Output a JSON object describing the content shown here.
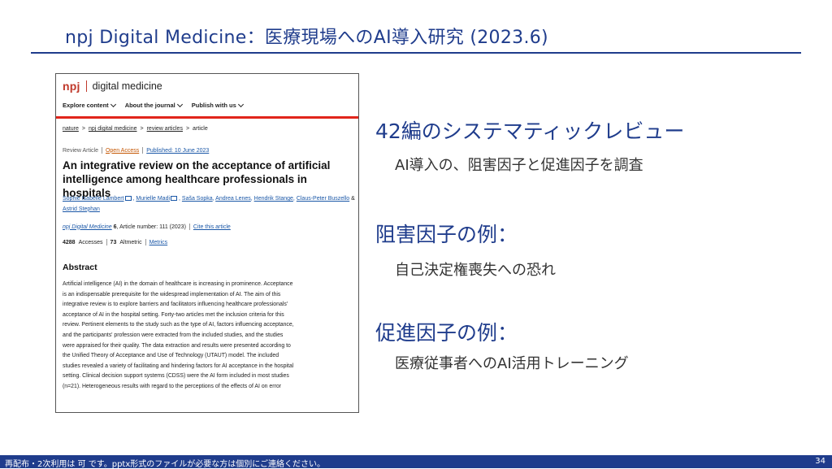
{
  "slide": {
    "title": "npj Digital Medicine：医療現場へのAI導入研究 (2023.6)",
    "footer_note": "再配布・2次利用は 可 です。pptx形式のファイルが必要な方は個別にご連絡ください。",
    "page_number": "34"
  },
  "article": {
    "brand_logo": "npj",
    "brand_name": "digital medicine",
    "nav": [
      "Explore content",
      "About the journal",
      "Publish with us"
    ],
    "breadcrumb": [
      "nature",
      "npj digital medicine",
      "review articles",
      "article"
    ],
    "meta": {
      "type": "Review Article",
      "open_access": "Open Access",
      "published": "Published: 10 June 2023"
    },
    "title": "An integrative review on the acceptance of artificial intelligence among healthcare professionals in hospitals",
    "authors": [
      "Sophie Isabelle Lambert",
      "Murielle Madi",
      "Saša Sopka",
      "Andrea Lenes",
      "Hendrik Stange",
      "Claus-Peter Buszello",
      "Astrid Stephan"
    ],
    "journal": {
      "name": "npj Digital Medicine",
      "volume": "6",
      "article": ", Article number: 111 (2023)",
      "cite": "Cite this article"
    },
    "metrics": {
      "accesses_num": "4288",
      "accesses_label": "Accesses",
      "altmetric_num": "73",
      "altmetric_label": "Altmetric",
      "metrics_link": "Metrics"
    },
    "abstract_heading": "Abstract",
    "abstract_lines": [
      "Artificial intelligence (AI) in the domain of healthcare is increasing in prominence. Acceptance",
      "is an indispensable prerequisite for the widespread implementation of AI. The aim of this",
      "integrative review is to explore barriers and facilitators influencing healthcare professionals'",
      "acceptance of AI in the hospital setting. Forty-two articles met the inclusion criteria for this",
      "review. Pertinent elements to the study such as the type of AI, factors influencing acceptance,",
      "and the participants' profession were extracted from the included studies, and the studies",
      "were appraised for their quality. The data extraction and results were presented according to",
      "the Unified Theory of Acceptance and Use of Technology (UTAUT) model. The included",
      "studies revealed a variety of facilitating and hindering factors for AI acceptance in the hospital",
      "setting. Clinical decision support systems (CDSS) were the AI form included in most studies",
      "(n=21). Heterogeneous results with regard to the perceptions of the effects of AI on error"
    ]
  },
  "points": [
    {
      "heading": "42編のシステマティックレビュー",
      "detail": "AI導入の、阻害因子と促進因子を調査"
    },
    {
      "heading": "阻害因子の例：",
      "detail": "自己決定権喪失への恐れ"
    },
    {
      "heading": "促進因子の例：",
      "detail": "医療従事者へのAI活用トレーニング"
    }
  ]
}
